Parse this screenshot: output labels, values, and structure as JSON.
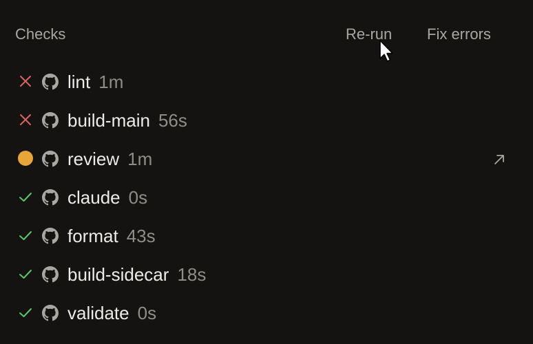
{
  "header": {
    "title": "Checks",
    "rerun_label": "Re-run",
    "fix_label": "Fix errors"
  },
  "colors": {
    "fail": "#d9645f",
    "pending": "#e8a53a",
    "success": "#5fc46b",
    "muted": "#8f8d88"
  },
  "checks": [
    {
      "name": "lint",
      "duration": "1m",
      "status": "failed",
      "icon": "x-icon"
    },
    {
      "name": "build-main",
      "duration": "56s",
      "status": "failed",
      "icon": "x-icon"
    },
    {
      "name": "review",
      "duration": "1m",
      "status": "pending",
      "icon": "pending-dot-icon"
    },
    {
      "name": "claude",
      "duration": "0s",
      "status": "success",
      "icon": "check-icon"
    },
    {
      "name": "format",
      "duration": "43s",
      "status": "success",
      "icon": "check-icon"
    },
    {
      "name": "build-sidecar",
      "duration": "18s",
      "status": "success",
      "icon": "check-icon"
    },
    {
      "name": "validate",
      "duration": "0s",
      "status": "success",
      "icon": "check-icon"
    }
  ]
}
